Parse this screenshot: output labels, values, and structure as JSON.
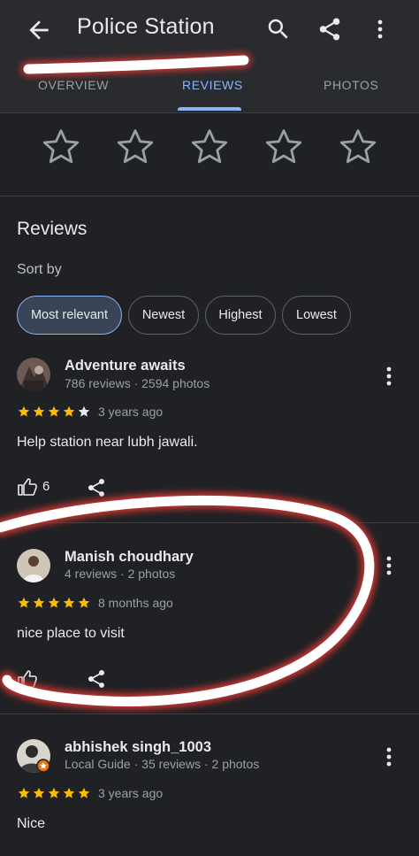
{
  "header": {
    "title": "Police Station"
  },
  "tabs": [
    {
      "label": "OVERVIEW"
    },
    {
      "label": "REVIEWS"
    },
    {
      "label": "PHOTOS"
    }
  ],
  "reviews_section": {
    "title": "Reviews",
    "sort_label": "Sort by",
    "sort_options": [
      "Most relevant",
      "Newest",
      "Highest",
      "Lowest"
    ],
    "selected_sort": "Most relevant"
  },
  "reviews": [
    {
      "author": "Adventure awaits",
      "meta": "786 reviews · 2594 photos",
      "rating": 4,
      "time": "3 years ago",
      "text": "Help station near lubh jawali.",
      "likes": "6"
    },
    {
      "author": "Manish choudhary",
      "meta": "4 reviews · 2 photos",
      "rating": 5,
      "time": "8 months ago",
      "text": "nice place to visit",
      "likes": ""
    },
    {
      "author": "abhishek singh_1003",
      "meta": "Local Guide · 35 reviews · 2 photos",
      "rating": 5,
      "time": "3 years ago",
      "text": "Nice",
      "likes": ""
    }
  ],
  "colors": {
    "background": "#202124",
    "accent": "#8ab4f8",
    "star": "#fbbc04",
    "scribble": "#ffffff",
    "scribble_glow": "#e53935"
  },
  "icons": [
    "back-arrow-icon",
    "search-icon",
    "share-icon",
    "more-vert-icon",
    "star-outline-icon",
    "star-icon",
    "thumb-up-icon",
    "avatar-icon"
  ]
}
